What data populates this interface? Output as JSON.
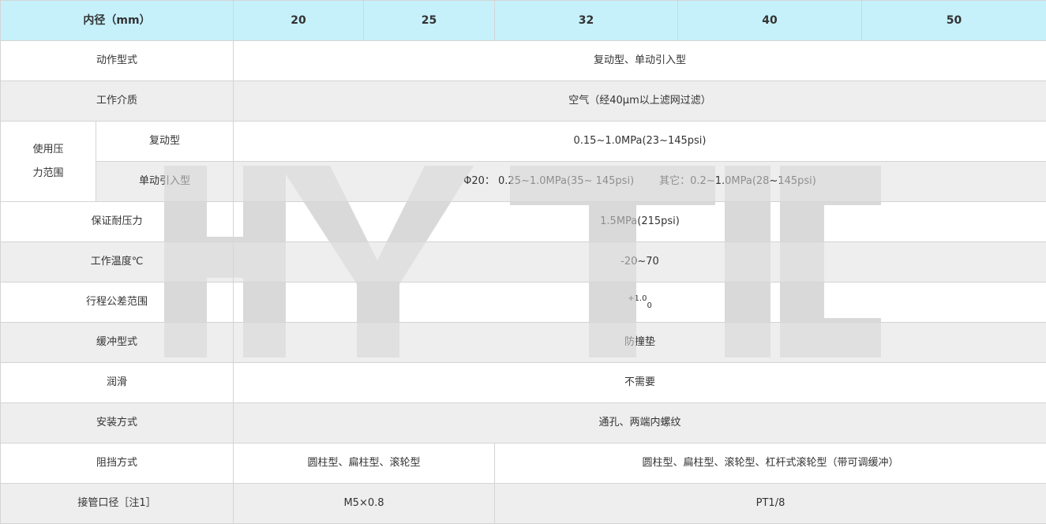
{
  "header": {
    "bore_label": "内径（mm）",
    "sizes": [
      "20",
      "25",
      "32",
      "40",
      "50"
    ]
  },
  "rows": {
    "action_type": {
      "label": "动作型式",
      "value": "复动型、单动引入型"
    },
    "medium": {
      "label": "工作介质",
      "value": "空气（经40μm以上滤网过滤）"
    },
    "pressure": {
      "group_label_line1": "使用压",
      "group_label_line2": "力范围",
      "double_acting": {
        "label": "复动型",
        "value": "0.15~1.0MPa(23~145psi)"
      },
      "single_acting": {
        "label": "单动引入型",
        "value_phi20": "Φ20： 0.25~1.0MPa(35~ 145psi)",
        "value_other": "其它：0.2~1.0MPa(28~145psi)"
      }
    },
    "proof_pressure": {
      "label": "保证耐压力",
      "value": "1.5MPa(215psi)"
    },
    "temperature": {
      "label": "工作温度℃",
      "value": "-20~70"
    },
    "stroke_tolerance": {
      "label": "行程公差范围",
      "upper": "+1.0",
      "lower": "0"
    },
    "cushion": {
      "label": "缓冲型式",
      "value": "防撞垫"
    },
    "lubrication": {
      "label": "润滑",
      "value": "不需要"
    },
    "mounting": {
      "label": "安装方式",
      "value": "通孔、两端内螺纹"
    },
    "stopper": {
      "label": "阻挡方式",
      "value_small": "圆柱型、扁柱型、滚轮型",
      "value_large": "圆柱型、扁柱型、滚轮型、杠杆式滚轮型（带可调缓冲）"
    },
    "port_size": {
      "label": "接管口径［注1］",
      "value_small": "M5×0.8",
      "value_large": "PT1/8"
    }
  },
  "watermark": {
    "text": "HYTIC",
    "color": "#d9d9d9"
  },
  "colors": {
    "header_bg": "#c6f1fb",
    "shaded_row_bg": "#ececec",
    "border": "#d4d4d4",
    "text": "#333333"
  }
}
